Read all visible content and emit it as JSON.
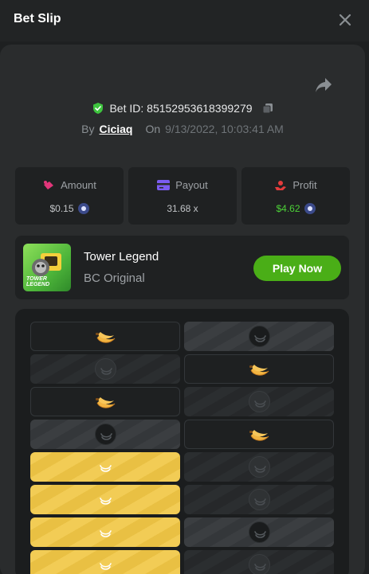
{
  "header": {
    "title": "Bet Slip"
  },
  "bet": {
    "id_label": "Bet ID: 85152953618399279",
    "by_label": "By",
    "username": "Ciciaq",
    "on_label": "On",
    "datetime": "9/13/2022, 10:03:41 AM"
  },
  "stats": {
    "amount": {
      "label": "Amount",
      "value": "$0.15"
    },
    "payout": {
      "label": "Payout",
      "value": "31.68 x"
    },
    "profit": {
      "label": "Profit",
      "value": "$4.62"
    }
  },
  "game": {
    "thumb_text": "TOWER LEGEND",
    "name": "Tower Legend",
    "subtitle": "BC Original",
    "play_label": "Play Now"
  },
  "colors": {
    "accent_green": "#4aae17",
    "profit_green": "#4cd137",
    "gold": "#f2cc55"
  },
  "board": {
    "rows": [
      [
        "banana-dark",
        "token-grey"
      ],
      [
        "token-dimgrey",
        "banana-dark"
      ],
      [
        "banana-dark",
        "token-dimgrey"
      ],
      [
        "token-grey",
        "banana-dark"
      ],
      [
        "gold",
        "token-dimgrey"
      ],
      [
        "gold",
        "token-dimgrey"
      ],
      [
        "gold",
        "token-grey"
      ],
      [
        "gold",
        "token-dimgrey"
      ]
    ]
  }
}
